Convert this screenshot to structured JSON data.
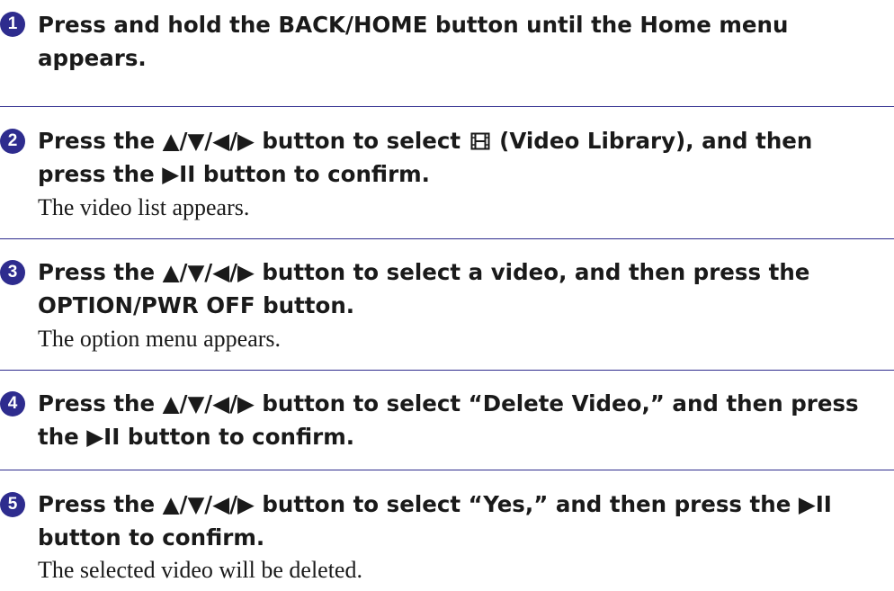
{
  "steps": [
    {
      "number": "1",
      "line1": "Press and hold the BACK/HOME button until the Home menu",
      "line2": "appears.",
      "result": ""
    },
    {
      "number": "2",
      "line1_before_icon": "Press the ▲/▼/◀/▶ button to select ",
      "icon": "video-library-icon",
      "line1_after_icon": " (Video Library), and then",
      "line2": "press the ▶II button to confirm.",
      "result": "The video list appears."
    },
    {
      "number": "3",
      "line1": "Press the ▲/▼/◀/▶ button to select a video, and then press the",
      "line2": "OPTION/PWR OFF button.",
      "result": "The option menu appears."
    },
    {
      "number": "4",
      "line1": "Press the ▲/▼/◀/▶ button to select “Delete Video,” and then press",
      "line2": "the ▶II button to confirm.",
      "result": ""
    },
    {
      "number": "5",
      "line1": "Press the ▲/▼/◀/▶ button to select “Yes,” and then press the ▶II",
      "line2": "button to confirm.",
      "result": "The selected video will be deleted."
    }
  ],
  "colors": {
    "accent": "#2e2c8e",
    "text": "#1a1a1a"
  }
}
